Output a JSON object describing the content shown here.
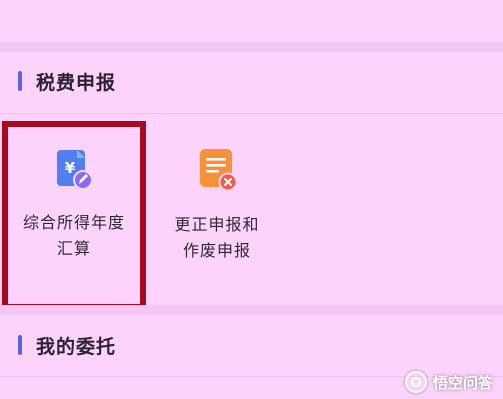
{
  "sections": [
    {
      "title": "税费申报",
      "accent_color": "#5a63e0"
    },
    {
      "title": "我的委托",
      "accent_color": "#5a63e0"
    }
  ],
  "tiles": [
    {
      "label": "综合所得年度\n汇算",
      "icon": "yuan-document-edit-icon",
      "icon_color": "#4f7ff0",
      "badge_color": "#8a6cf0",
      "highlighted": true
    },
    {
      "label": "更正申报和\n作废申报",
      "icon": "document-cancel-icon",
      "icon_color": "#f79036",
      "badge_color": "#f15c4a",
      "highlighted": false
    }
  ],
  "watermark": {
    "text": "悟空问答"
  },
  "colors": {
    "background": "#fbd3fb",
    "highlight_border": "#a70a1e"
  }
}
